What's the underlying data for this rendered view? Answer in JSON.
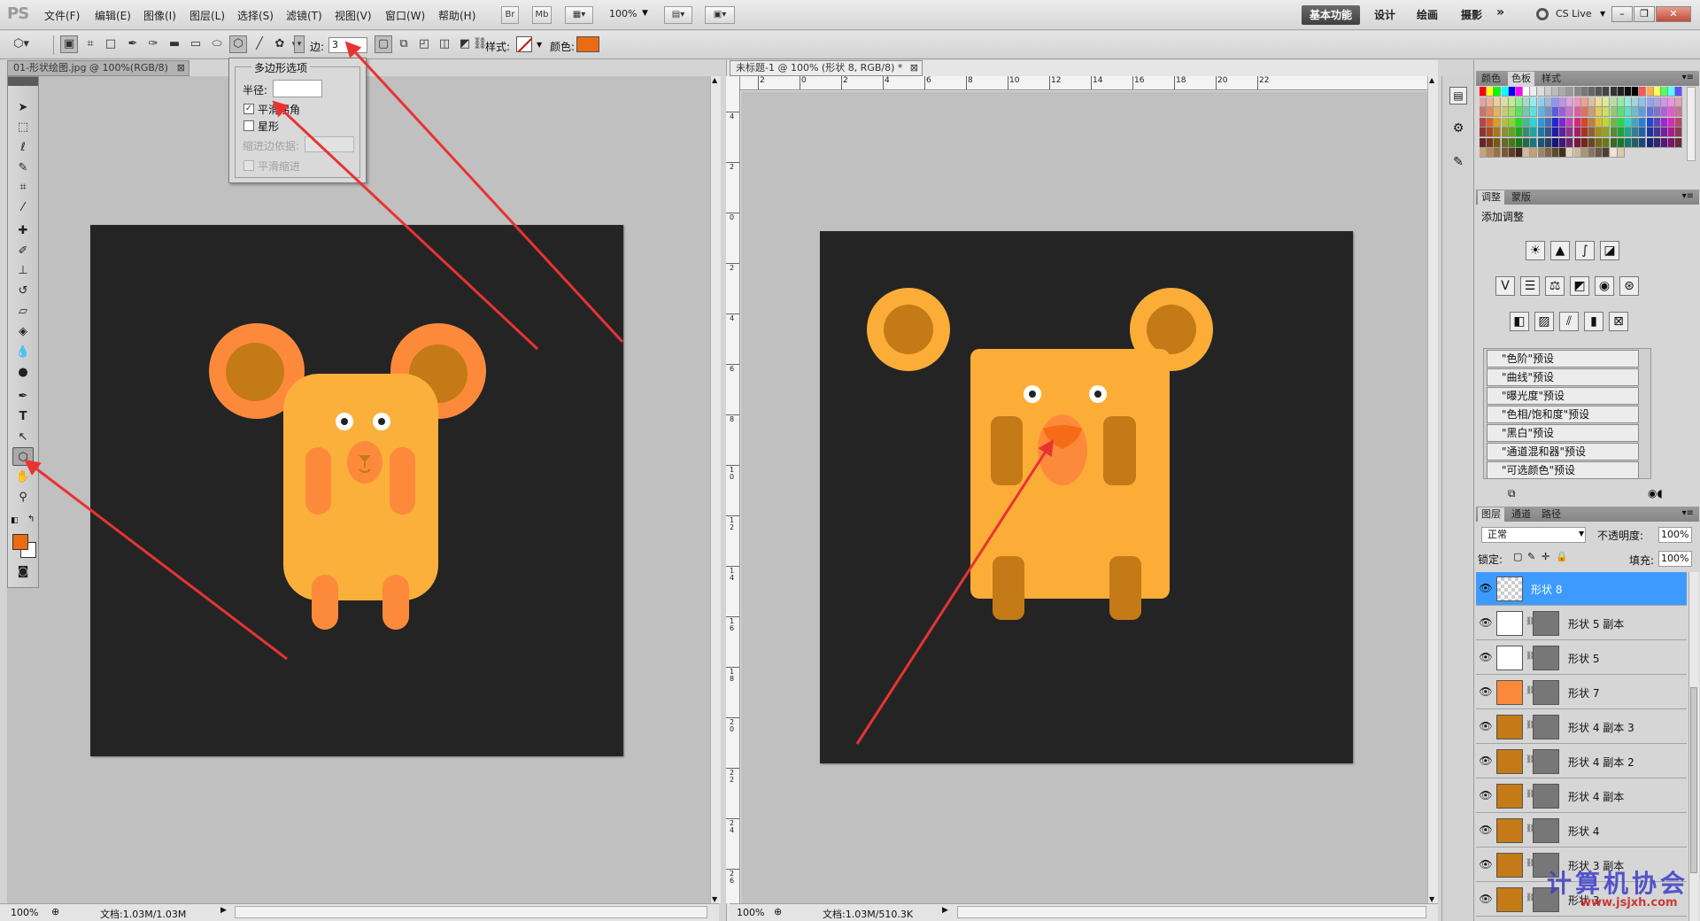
{
  "app": {
    "logo": "PS"
  },
  "menu": [
    "文件(F)",
    "编辑(E)",
    "图像(I)",
    "图层(L)",
    "选择(S)",
    "滤镜(T)",
    "视图(V)",
    "窗口(W)",
    "帮助(H)"
  ],
  "menubar": {
    "bridge": "Br",
    "minibridge": "Mb",
    "zoom": "100%"
  },
  "workspace": {
    "active": "基本功能",
    "items": [
      "设计",
      "绘画",
      "摄影"
    ],
    "more": "»",
    "cs_live": "CS Live"
  },
  "options": {
    "sides_label": "边:",
    "sides_value": "3",
    "style_label": "样式:",
    "color_label": "颜色:",
    "color": "#ea6b12"
  },
  "poly_popup": {
    "title": "多边形选项",
    "radius_label": "半径:",
    "radius_value": "",
    "smooth_corners": "平滑拐角",
    "smooth_corners_checked": true,
    "star": "星形",
    "star_checked": false,
    "indent_label": "缩进边依据:",
    "smooth_indents": "平滑缩进"
  },
  "doc_left": {
    "tab": "01-形状绘图.jpg @ 100%(RGB/8)",
    "zoom": "100%",
    "status": "文档:1.03M/1.03M"
  },
  "doc_right": {
    "tab": "未标题-1 @ 100% (形状 8, RGB/8) *",
    "zoom": "100%",
    "status": "文档:1.03M/510.3K"
  },
  "ruler_h": [
    "2",
    "0",
    "2",
    "4",
    "6",
    "8",
    "10",
    "12",
    "14",
    "16",
    "18",
    "20",
    "22"
  ],
  "ruler_v": [
    "4",
    "2",
    "0",
    "2",
    "4",
    "6",
    "8",
    "1 0",
    "1 2",
    "1 4",
    "1 6",
    "1 8",
    "2 0",
    "2 2",
    "2 4",
    "2 6"
  ],
  "panels": {
    "swatch_tabs": [
      "颜色",
      "色板",
      "样式"
    ],
    "adjust_tabs": [
      "调整",
      "蒙版"
    ],
    "adjust_title": "添加调整",
    "presets": [
      "\"色阶\"预设",
      "\"曲线\"预设",
      "\"曝光度\"预设",
      "\"色相/饱和度\"预设",
      "\"黑白\"预设",
      "\"通道混和器\"预设",
      "\"可选颜色\"预设"
    ],
    "layer_tabs": [
      "图层",
      "通道",
      "路径"
    ],
    "blend_mode": "正常",
    "opacity_label": "不透明度:",
    "opacity_value": "100%",
    "lock_label": "锁定:",
    "fill_label": "填充:",
    "fill_value": "100%"
  },
  "layers": [
    {
      "name": "形状 8",
      "color": "transparent",
      "selected": true
    },
    {
      "name": "形状 5 副本",
      "color": "#ffffff",
      "selected": false
    },
    {
      "name": "形状 5",
      "color": "#ffffff",
      "selected": false
    },
    {
      "name": "形状 7",
      "color": "#fd8a3b",
      "selected": false
    },
    {
      "name": "形状 4 副本 3",
      "color": "#c47a16",
      "selected": false
    },
    {
      "name": "形状 4 副本 2",
      "color": "#c47a16",
      "selected": false
    },
    {
      "name": "形状 4 副本",
      "color": "#c47a16",
      "selected": false
    },
    {
      "name": "形状 4",
      "color": "#c47a16",
      "selected": false
    },
    {
      "name": "形状 3 副本",
      "color": "#c47a16",
      "selected": false
    },
    {
      "name": "形状 3",
      "color": "#c47a16",
      "selected": false
    }
  ],
  "watermark": {
    "text": "计算机协会",
    "url": "www.jsjxh.com"
  },
  "colors": {
    "canvas_bg": "#242424",
    "mouse_body": "#fbb03b",
    "mouse_ear_outer": "#fd8a3b",
    "mouse_ear_inner": "#c47a16",
    "bear_body": "#fbad38",
    "bear_dark": "#c47a16",
    "bear_nose": "#fd8a3b",
    "bear_nose_tip": "#f66c16",
    "arrow": "#e83333"
  }
}
